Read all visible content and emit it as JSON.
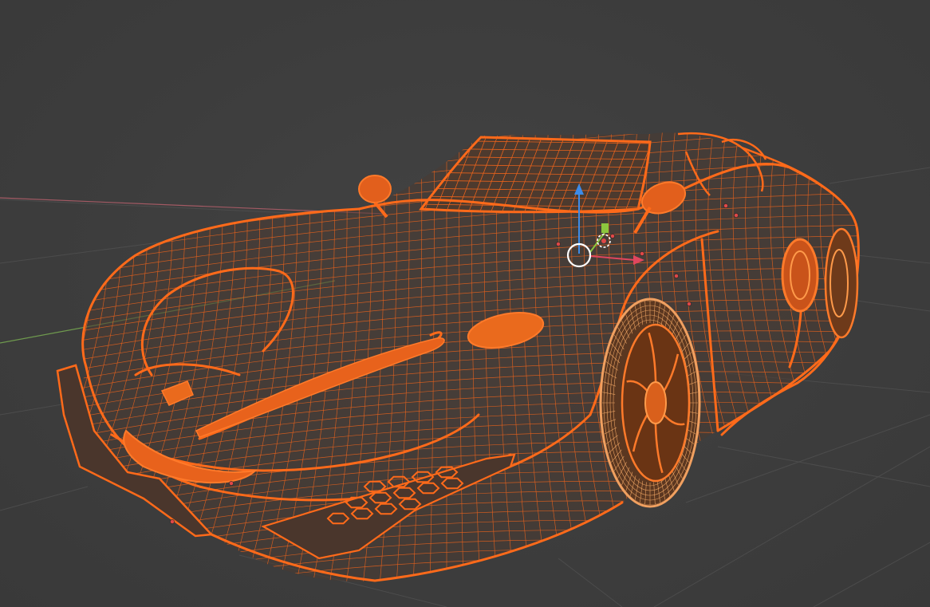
{
  "viewport": {
    "background_color": "#3d3d3d",
    "grid_color": "#4c4c4c",
    "x_axis_color": "#a35a64",
    "y_axis_color": "#6f9a4e"
  },
  "object": {
    "selection_color": "#ff6a1a",
    "wire_color": "#e8621c",
    "dark_wire_color": "#9a3e10",
    "selected": true,
    "display_mode": "wireframe"
  },
  "gizmo": {
    "x_color": "#e0465e",
    "y_color": "#8cc63e",
    "z_color": "#3d8be8",
    "center_color": "#ffffff",
    "icon": "transform-gizmo-icon"
  },
  "origin_dot_color": "#e04848"
}
